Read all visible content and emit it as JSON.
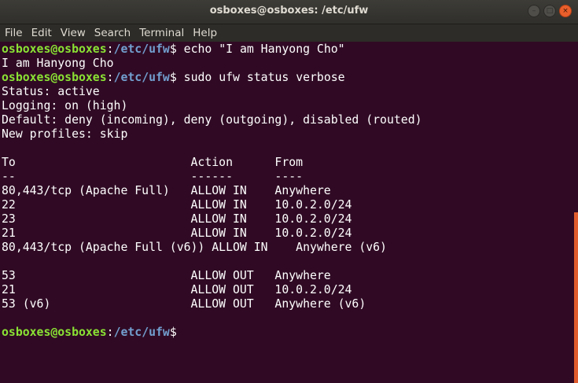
{
  "window": {
    "title": "osboxes@osboxes: /etc/ufw",
    "buttons": {
      "minimize": "–",
      "maximize": "□",
      "close": "×"
    }
  },
  "menu": [
    "File",
    "Edit",
    "View",
    "Search",
    "Terminal",
    "Help"
  ],
  "prompt": {
    "user_host": "osboxes@osboxes",
    "colon": ":",
    "path": "/etc/ufw",
    "symbol": "$"
  },
  "lines": [
    {
      "type": "prompt",
      "command": " echo \"I am Hanyong Cho\""
    },
    {
      "type": "output",
      "text": "I am Hanyong Cho"
    },
    {
      "type": "prompt",
      "command": " sudo ufw status verbose"
    },
    {
      "type": "output",
      "text": "Status: active"
    },
    {
      "type": "output",
      "text": "Logging: on (high)"
    },
    {
      "type": "output",
      "text": "Default: deny (incoming), deny (outgoing), disabled (routed)"
    },
    {
      "type": "output",
      "text": "New profiles: skip"
    },
    {
      "type": "output",
      "text": ""
    },
    {
      "type": "output",
      "text": "To                         Action      From"
    },
    {
      "type": "output",
      "text": "--                         ------      ----"
    },
    {
      "type": "output",
      "text": "80,443/tcp (Apache Full)   ALLOW IN    Anywhere"
    },
    {
      "type": "output",
      "text": "22                         ALLOW IN    10.0.2.0/24"
    },
    {
      "type": "output",
      "text": "23                         ALLOW IN    10.0.2.0/24"
    },
    {
      "type": "output",
      "text": "21                         ALLOW IN    10.0.2.0/24"
    },
    {
      "type": "output",
      "text": "80,443/tcp (Apache Full (v6)) ALLOW IN    Anywhere (v6)"
    },
    {
      "type": "output",
      "text": ""
    },
    {
      "type": "output",
      "text": "53                         ALLOW OUT   Anywhere"
    },
    {
      "type": "output",
      "text": "21                         ALLOW OUT   10.0.2.0/24"
    },
    {
      "type": "output",
      "text": "53 (v6)                    ALLOW OUT   Anywhere (v6)"
    },
    {
      "type": "output",
      "text": ""
    },
    {
      "type": "prompt",
      "command": ""
    }
  ],
  "colors": {
    "background": "#300a24",
    "user_host": "#8ae234",
    "path": "#729fcf",
    "text": "#ffffff",
    "scrollbar": "#e05c2e"
  }
}
